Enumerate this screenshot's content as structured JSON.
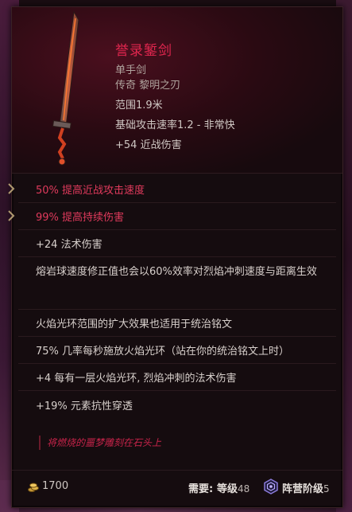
{
  "item": {
    "name": "誉录錾剑",
    "type": "单手剑",
    "rarity": "传奇  黎明之刃",
    "range": "范围1.9米",
    "attack_speed": "基础攻击速率1.2 - 非常快",
    "implicit": "+54 近战伤害"
  },
  "affixes": [
    "50% 提高近战攻击速度",
    "99% 提高持续伤害",
    "+24 法术伤害",
    "熔岩球速度修正值也会以60%效率对烈焰冲刺速度与距离生效",
    "火焰光环范围的扩大效果也适用于统治铭文",
    "75% 几率每秒施放火焰光环（站在你的统治铭文上时）",
    "+4 每有一层火焰光环, 烈焰冲刺的法术伤害",
    "+19% 元素抗性穿透"
  ],
  "flavor_text": "将燃烧的噩梦雕刻在石头上",
  "footer": {
    "gold": "1700",
    "require_label": "需要:",
    "level_label": "等级",
    "level_value": "48",
    "faction_label": "阵营阶级",
    "faction_value": "5"
  },
  "colors": {
    "name": "#e0264e",
    "crafted_affix": "#e03a5c",
    "flavor": "#c8244a"
  },
  "icons": [
    "sword-item-icon",
    "gold-coins-icon",
    "faction-rank-icon",
    "chevron-right-icon"
  ]
}
